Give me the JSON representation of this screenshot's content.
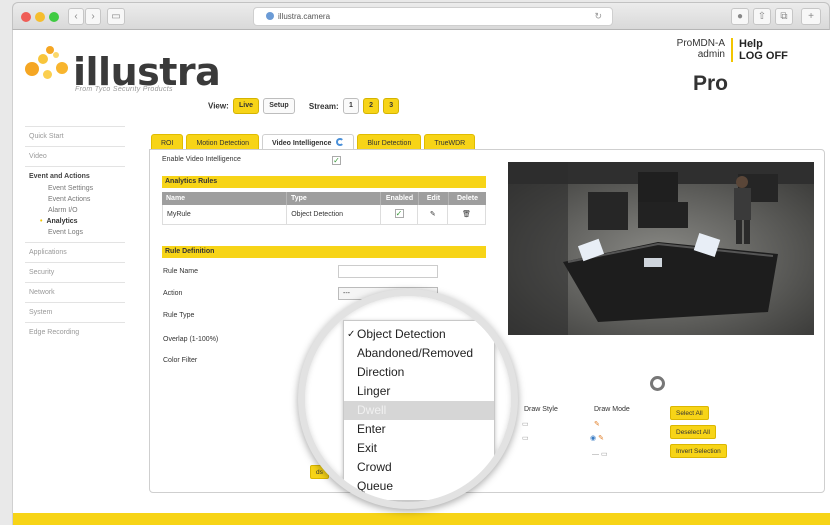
{
  "browser": {
    "url": "illustra.camera",
    "buttons": [
      "‹",
      "›",
      "▭"
    ]
  },
  "brand": {
    "logo": "illustra",
    "tagline": "From Tyco Security Products",
    "product": "Pro"
  },
  "user": {
    "device": "ProMDN-A",
    "role": "admin",
    "help": "Help",
    "logoff": "LOG OFF"
  },
  "view": {
    "label": "View:",
    "options": [
      "Live",
      "Setup"
    ],
    "stream_label": "Stream:",
    "streams": [
      "1",
      "2",
      "3"
    ]
  },
  "sidebar": {
    "items": [
      {
        "label": "Quick Start"
      },
      {
        "label": "Video"
      },
      {
        "label": "Event and Actions"
      },
      {
        "label": "Applications"
      },
      {
        "label": "Security"
      },
      {
        "label": "Network"
      },
      {
        "label": "System"
      },
      {
        "label": "Edge Recording"
      }
    ],
    "sub": [
      "Event Settings",
      "Event Actions",
      "Alarm I/O",
      "Analytics",
      "Event Logs"
    ]
  },
  "tabs": [
    "ROI",
    "Motion Detection",
    "Video Intelligence",
    "Blur Detection",
    "TrueWDR"
  ],
  "form": {
    "enable_label": "Enable Video Intelligence",
    "analytics_rules": "Analytics Rules",
    "columns": [
      "Name",
      "Type",
      "Enabled",
      "Edit",
      "Delete"
    ],
    "rule": {
      "name": "MyRule",
      "type": "Object Detection"
    },
    "rule_definition": "Rule Definition",
    "rule_name_label": "Rule Name",
    "action_label": "Action",
    "action_value": "---",
    "rule_type_label": "Rule Type",
    "overlap_label": "Overlap (1-100%)",
    "color_filter_label": "Color Filter",
    "draw_style": "Draw Style",
    "draw_mode": "Draw Mode",
    "select_all": "Select All",
    "deselect_all": "Deselect All",
    "invert": "Invert Selection",
    "partial_button": "ds"
  },
  "dropdown": {
    "options": [
      "Object Detection",
      "Abandoned/Removed",
      "Direction",
      "Linger",
      "Dwell",
      "Enter",
      "Exit",
      "Crowd",
      "Queue"
    ]
  },
  "colors": {
    "accent": "#f7d417",
    "brand_orange": "#f5a623"
  }
}
